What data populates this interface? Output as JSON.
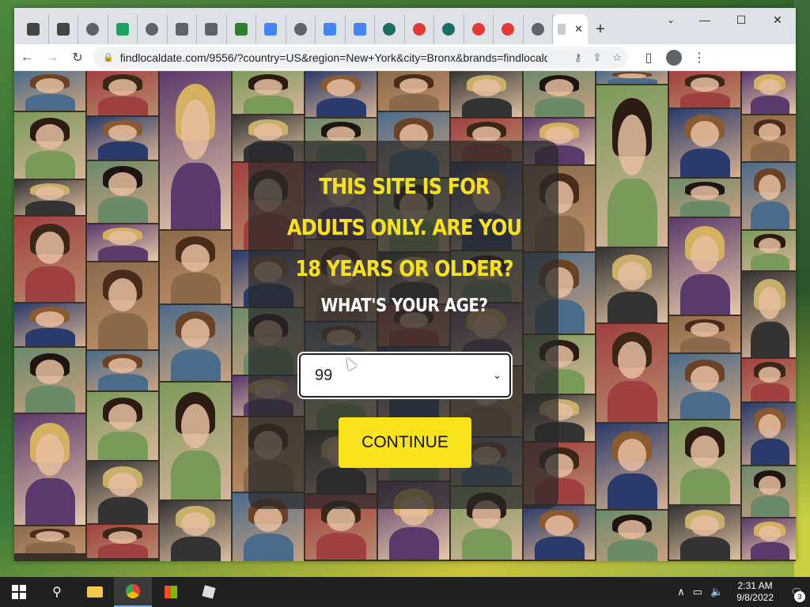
{
  "browser": {
    "tabs": [
      {
        "icon": "generic-site-icon",
        "color": "#444444"
      },
      {
        "icon": "generic-site-icon",
        "color": "#444444"
      },
      {
        "icon": "globe-icon",
        "color": "#5f6368"
      },
      {
        "icon": "link-icon",
        "color": "#1aa260"
      },
      {
        "icon": "globe-icon",
        "color": "#5f6368"
      },
      {
        "icon": "cube-icon",
        "color": "#5f6368"
      },
      {
        "icon": "cube-icon",
        "color": "#5f6368"
      },
      {
        "icon": "puzzle-icon",
        "color": "#2e7d32"
      },
      {
        "icon": "google-icon",
        "color": "#4285f4"
      },
      {
        "icon": "globe-icon",
        "color": "#5f6368"
      },
      {
        "icon": "google-icon",
        "color": "#4285f4"
      },
      {
        "icon": "google-icon",
        "color": "#4285f4"
      },
      {
        "icon": "teal-circle-icon",
        "color": "#1b6e63"
      },
      {
        "icon": "flame-icon",
        "color": "#e53935"
      },
      {
        "icon": "teal-circle-icon",
        "color": "#1b6e63"
      },
      {
        "icon": "flame-icon",
        "color": "#e53935"
      },
      {
        "icon": "flame-icon",
        "color": "#e53935"
      },
      {
        "icon": "globe-icon",
        "color": "#5f6368"
      }
    ],
    "active_tab_close": "✕",
    "new_tab": "+",
    "url": "findlocaldate.com/9556/?country=US&region=New+York&city=Bronx&brands=findlocaldate.com&c..."
  },
  "modal": {
    "title": "THIS SITE IS FOR ADULTS ONLY. ARE YOU 18 YEARS OR OLDER?",
    "subtitle": "WHAT'S YOUR AGE?",
    "age_value": "99",
    "continue_label": "CONTINUE"
  },
  "colors": {
    "title_yellow": "#f6e11f",
    "button_yellow": "#f8e21c"
  },
  "taskbar": {
    "time": "2:31 AM",
    "date": "9/8/2022",
    "notification_count": "3"
  }
}
